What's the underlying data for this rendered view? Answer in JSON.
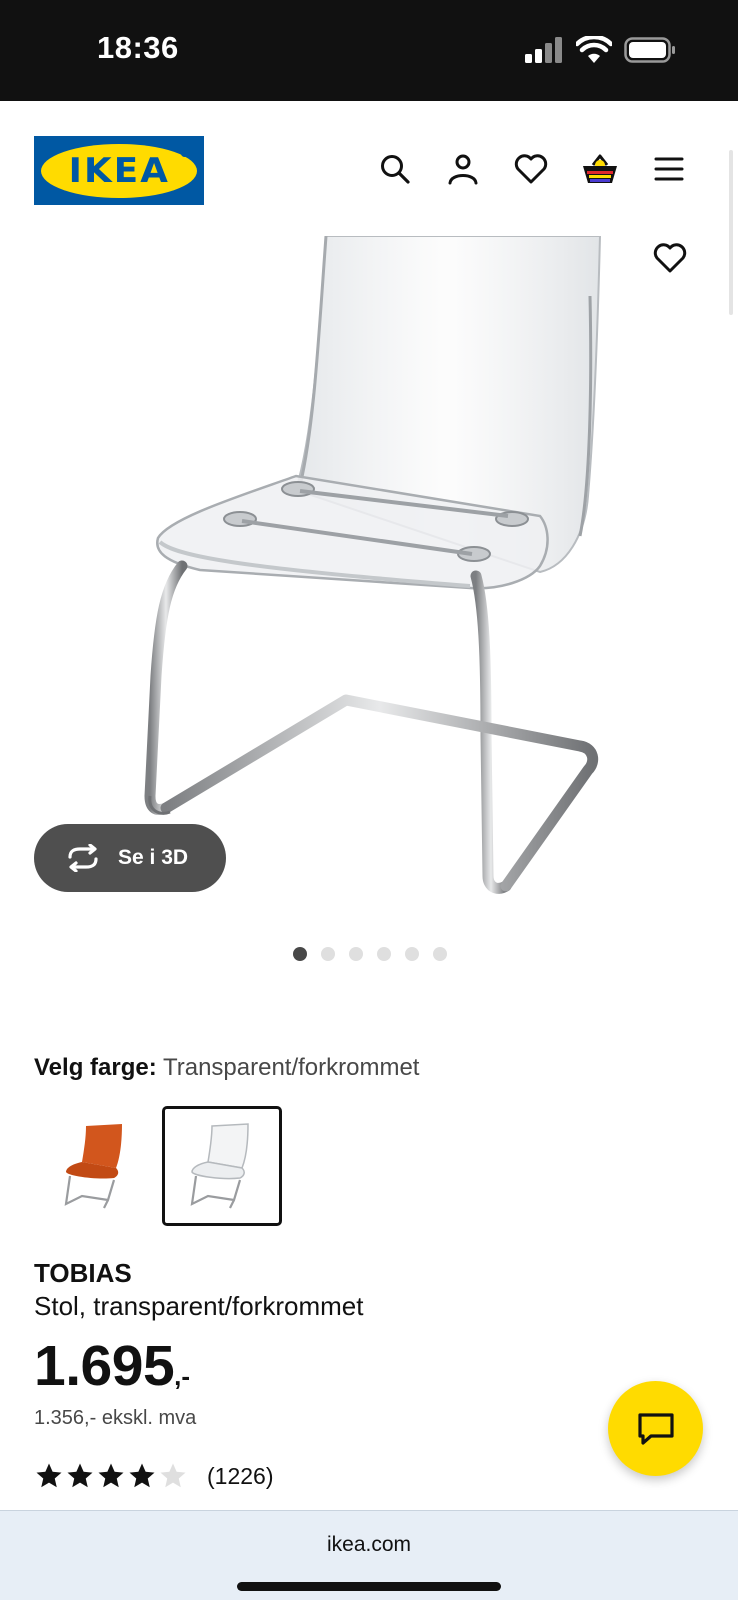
{
  "status_bar": {
    "time": "18:36",
    "icons": [
      "cellular-signal-icon",
      "wifi-icon",
      "battery-icon"
    ]
  },
  "header": {
    "logo_text": "IKEA",
    "icons": [
      "search-icon",
      "account-icon",
      "wishlist-heart-icon",
      "shopping-bag-icon",
      "menu-icon"
    ]
  },
  "gallery": {
    "view_3d_label": "Se i 3D",
    "page_count": 6,
    "active_page": 1
  },
  "color_selector": {
    "label": "Velg farge:",
    "selected_value": "Transparent/forkrommet",
    "options": [
      {
        "name": "orange-chair",
        "selected": false
      },
      {
        "name": "transparent-chair",
        "selected": true
      }
    ]
  },
  "product": {
    "name": "TOBIAS",
    "description": "Stol, transparent/forkrommet",
    "price": "1.695",
    "price_suffix": ",-",
    "price_excl_vat": "1.356,- ekskl. mva",
    "rating_stars": 4,
    "rating_max": 5,
    "review_count": "(1226)"
  },
  "browser": {
    "url": "ikea.com"
  },
  "colors": {
    "ikea_blue": "#0058a3",
    "ikea_yellow": "#ffdb00",
    "button_dark": "#4f4f4f"
  }
}
